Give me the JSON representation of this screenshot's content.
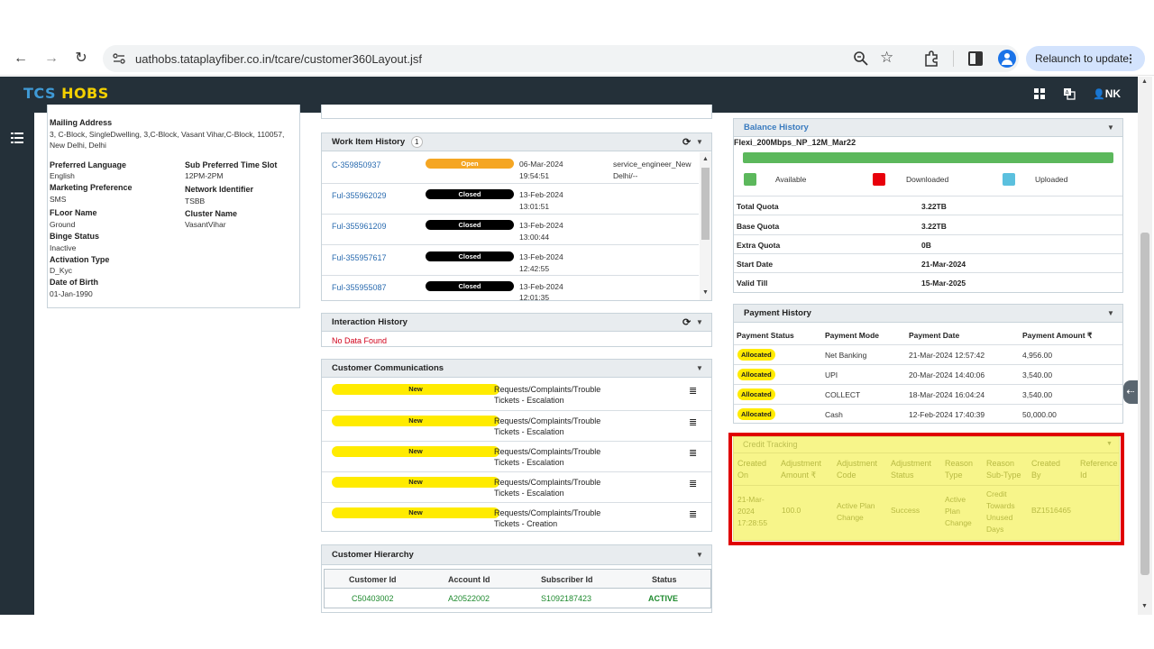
{
  "browser": {
    "url": "uathobs.tataplayfiber.co.in/tcare/customer360Layout.jsf",
    "relaunch_label": "Relaunch to update"
  },
  "app": {
    "brand_tcs": "TCS",
    "brand_hobs": "HOBS",
    "user": "NK"
  },
  "customer": {
    "mailing_label": "Mailing Address",
    "mailing_line1": "3, C-Block, SingleDwelling, 3,C-Block, Vasant Vihar,C-Block, 110057,",
    "mailing_line2": "New Delhi, Delhi",
    "fields_left": [
      {
        "label": "Preferred Language",
        "value": "English"
      },
      {
        "label": "Marketing Preference",
        "value": "SMS"
      },
      {
        "label": "FLoor Name",
        "value": "Ground"
      },
      {
        "label": "Binge Status",
        "value": "Inactive"
      },
      {
        "label": "Activation Type",
        "value": "D_Kyc"
      },
      {
        "label": "Date of Birth",
        "value": "01-Jan-1990"
      }
    ],
    "fields_right": [
      {
        "label": "Sub Preferred Time Slot",
        "value": "12PM-2PM"
      },
      {
        "label": "Network Identifier",
        "value": "TSBB"
      },
      {
        "label": "Cluster Name",
        "value": "VasantVihar"
      }
    ]
  },
  "work_items": {
    "title": "Work Item History",
    "count": "1",
    "rows": [
      {
        "id": "C-359850937",
        "status": "Open",
        "date": "06-Mar-2024",
        "time": "19:54:51",
        "extra1": "service_engineer_New",
        "extra2": "Delhi/--"
      },
      {
        "id": "Ful-355962029",
        "status": "Closed",
        "date": "13-Feb-2024",
        "time": "13:01:51",
        "extra1": "",
        "extra2": ""
      },
      {
        "id": "Ful-355961209",
        "status": "Closed",
        "date": "13-Feb-2024",
        "time": "13:00:44",
        "extra1": "",
        "extra2": ""
      },
      {
        "id": "Ful-355957617",
        "status": "Closed",
        "date": "13-Feb-2024",
        "time": "12:42:55",
        "extra1": "",
        "extra2": ""
      },
      {
        "id": "Ful-355955087",
        "status": "Closed",
        "date": "13-Feb-2024",
        "time": "12:01:35",
        "extra1": "",
        "extra2": ""
      }
    ]
  },
  "interaction": {
    "title": "Interaction History",
    "empty": "No Data Found"
  },
  "communications": {
    "title": "Customer Communications",
    "rows": [
      {
        "status": "New",
        "line1": "Requests/Complaints/Trouble",
        "line2": "Tickets - Escalation"
      },
      {
        "status": "New",
        "line1": "Requests/Complaints/Trouble",
        "line2": "Tickets - Escalation"
      },
      {
        "status": "New",
        "line1": "Requests/Complaints/Trouble",
        "line2": "Tickets - Escalation"
      },
      {
        "status": "New",
        "line1": "Requests/Complaints/Trouble",
        "line2": "Tickets - Escalation"
      },
      {
        "status": "New",
        "line1": "Requests/Complaints/Trouble",
        "line2": "Tickets - Creation"
      }
    ]
  },
  "hierarchy": {
    "title": "Customer Hierarchy",
    "headers": [
      "Customer Id",
      "Account Id",
      "Subscriber Id",
      "Status"
    ],
    "row": [
      "C50403002",
      "A20522002",
      "S1092187423",
      "ACTIVE"
    ]
  },
  "balance": {
    "title": "Balance History",
    "plan": "Flexi_200Mbps_NP_12M_Mar22",
    "available_fraction": 1.0,
    "legend": [
      {
        "label": "Available",
        "color": "#5cb85c"
      },
      {
        "label": "Downloaded",
        "color": "#e8000b"
      },
      {
        "label": "Uploaded",
        "color": "#5bc0de"
      }
    ],
    "rows": [
      {
        "label": "Total Quota",
        "value": "3.22TB"
      },
      {
        "label": "Base Quota",
        "value": "3.22TB"
      },
      {
        "label": "Extra Quota",
        "value": "0B"
      },
      {
        "label": "Start Date",
        "value": "21-Mar-2024"
      },
      {
        "label": "Valid Till",
        "value": "15-Mar-2025"
      }
    ]
  },
  "payment": {
    "title": "Payment History",
    "headers": [
      "Payment Status",
      "Payment Mode",
      "Payment Date",
      "Payment Amount ₹"
    ],
    "rows": [
      {
        "status": "Allocated",
        "mode": "Net Banking",
        "date": "21-Mar-2024 12:57:42",
        "amount": "4,956.00"
      },
      {
        "status": "Allocated",
        "mode": "UPI",
        "date": "20-Mar-2024 14:40:06",
        "amount": "3,540.00"
      },
      {
        "status": "Allocated",
        "mode": "COLLECT",
        "date": "18-Mar-2024 16:04:24",
        "amount": "3,540.00"
      },
      {
        "status": "Allocated",
        "mode": "Cash",
        "date": "12-Feb-2024 17:40:39",
        "amount": "50,000.00"
      }
    ]
  },
  "credit": {
    "title": "Credit Tracking",
    "headers": [
      [
        "Created",
        "On"
      ],
      [
        "Adjustment",
        "Amount ₹"
      ],
      [
        "Adjustment",
        "Code"
      ],
      [
        "Adjustment",
        "Status"
      ],
      [
        "Reason",
        "Type"
      ],
      [
        "Reason",
        "Sub-Type"
      ],
      [
        "Created",
        "By"
      ],
      [
        "Reference",
        "Id"
      ]
    ],
    "row": {
      "created_on": [
        "21-Mar-",
        "2024",
        "17:28:55"
      ],
      "amount": "100.0",
      "code": [
        "Active Plan",
        "Change"
      ],
      "status": "Success",
      "reason_type": [
        "Active",
        "Plan",
        "Change"
      ],
      "reason_sub": [
        "Credit",
        "Towards",
        "Unused",
        "Days"
      ],
      "created_by": "BZ1516465"
    }
  }
}
